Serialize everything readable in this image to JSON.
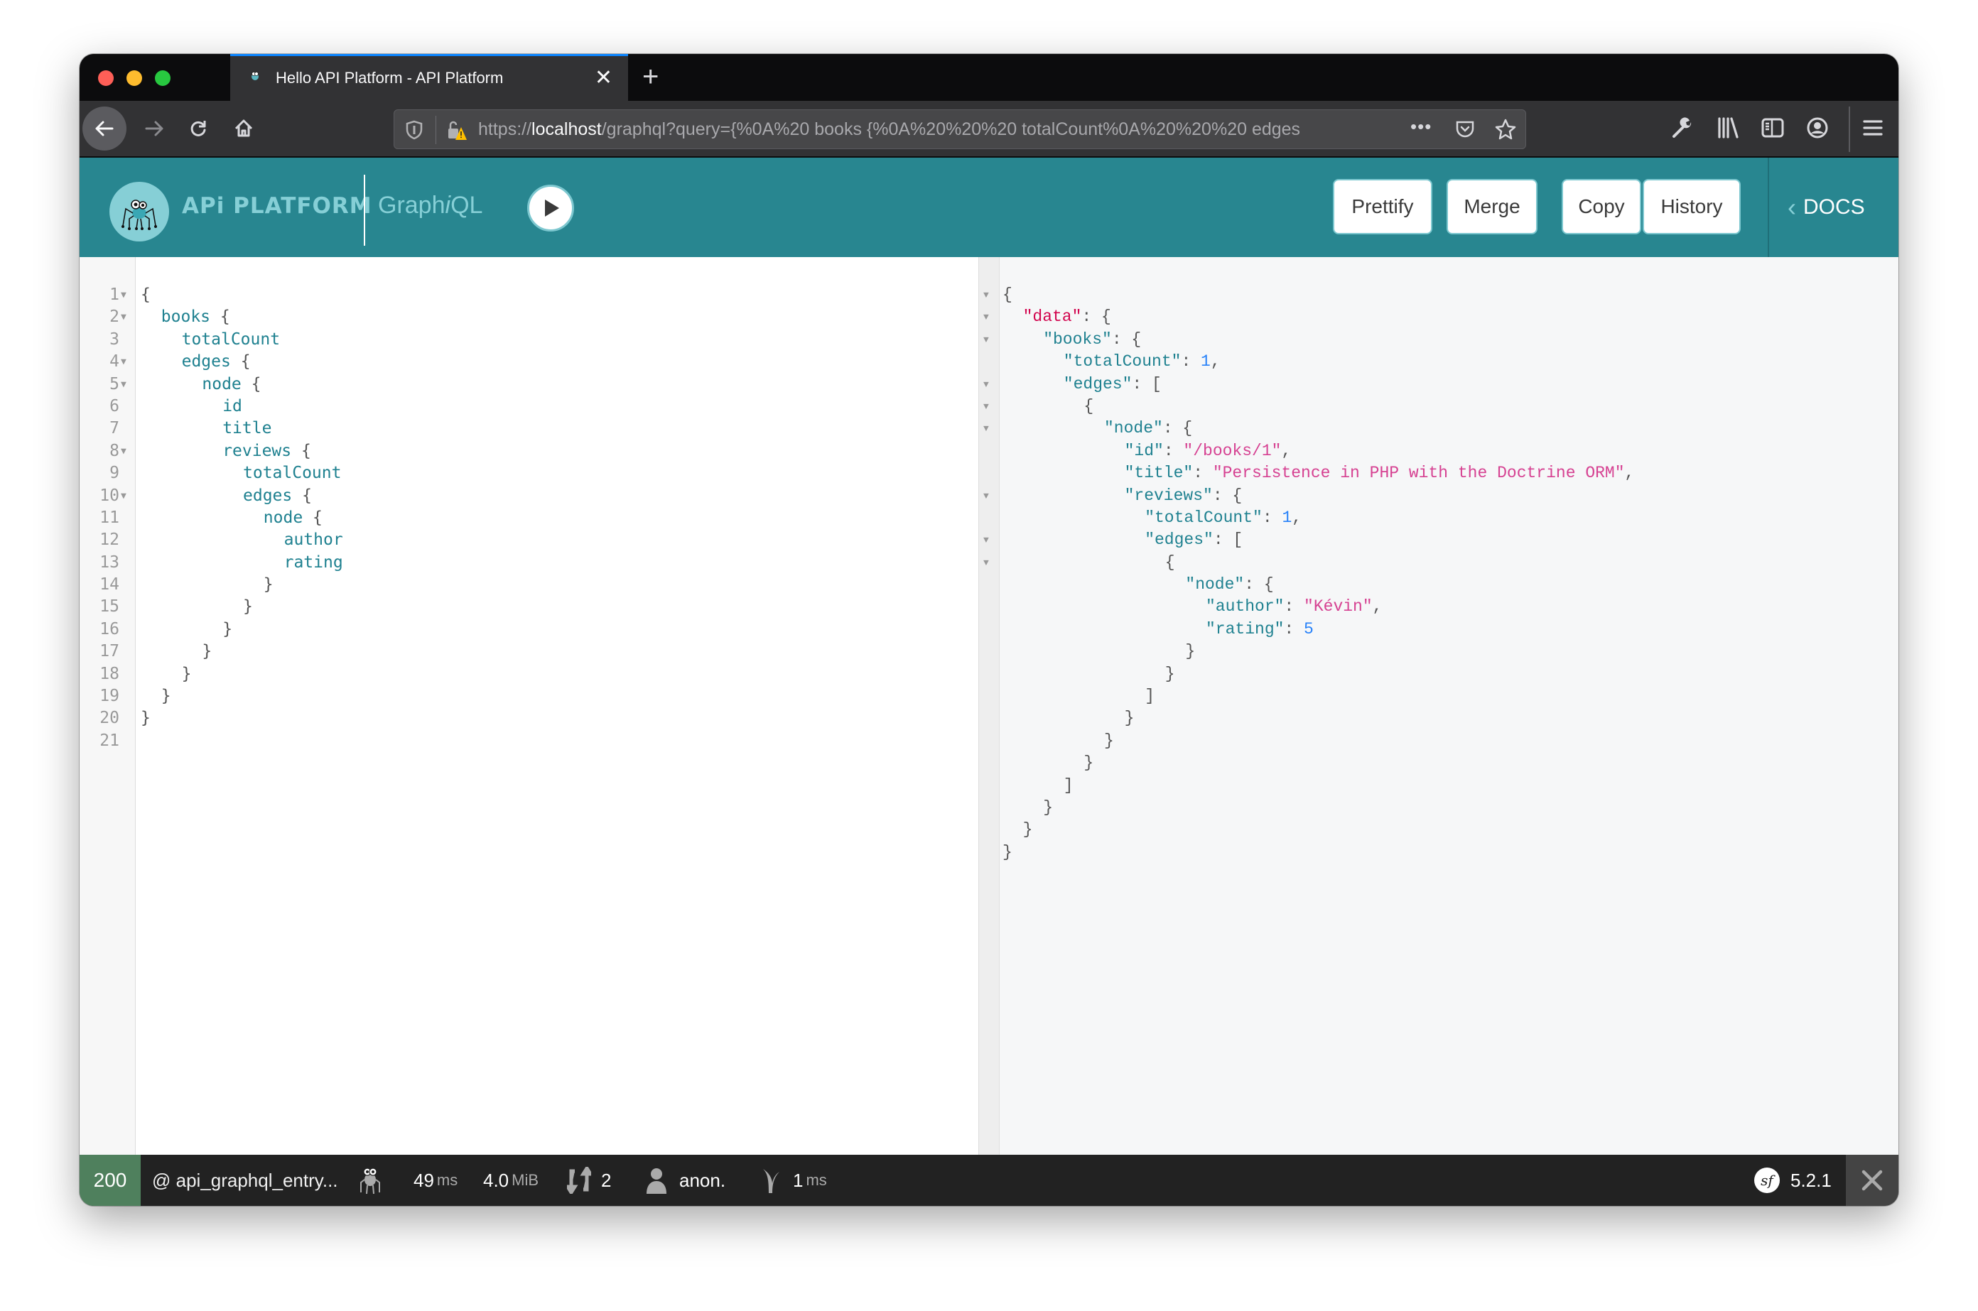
{
  "browser": {
    "tab": {
      "title": "Hello API Platform - API Platform",
      "favicon": "spider-favicon-icon"
    },
    "url": {
      "scheme": "https://",
      "host": "localhost",
      "path": "/graphql?query={%0A%20 books {%0A%20%20%20 totalCount%0A%20%20%20 edges"
    },
    "icons": [
      "back-icon",
      "forward-icon",
      "reload-icon",
      "home-icon",
      "shield-icon",
      "lock-warning-icon",
      "more-icon",
      "pocket-icon",
      "star-icon",
      "wrench-icon",
      "library-icon",
      "sidebar-icon",
      "account-icon",
      "menu-icon"
    ]
  },
  "graphiql": {
    "logo_text": "APi PLATFORM",
    "title_prefix": "Graph",
    "title_italic": "i",
    "title_suffix": "QL",
    "buttons": {
      "prettify": "Prettify",
      "merge": "Merge",
      "copy": "Copy",
      "history": "History"
    },
    "docs_label": "DOCS",
    "accent_color": "#288690"
  },
  "query_editor": {
    "lines": [
      {
        "n": "1",
        "fold": true,
        "indent": 0,
        "key": "",
        "tail": "{"
      },
      {
        "n": "2",
        "fold": true,
        "indent": 1,
        "key": "books",
        "tail": " {"
      },
      {
        "n": "3",
        "fold": false,
        "indent": 2,
        "key": "totalCount",
        "tail": ""
      },
      {
        "n": "4",
        "fold": true,
        "indent": 2,
        "key": "edges",
        "tail": " {"
      },
      {
        "n": "5",
        "fold": true,
        "indent": 3,
        "key": "node",
        "tail": " {"
      },
      {
        "n": "6",
        "fold": false,
        "indent": 4,
        "key": "id",
        "tail": ""
      },
      {
        "n": "7",
        "fold": false,
        "indent": 4,
        "key": "title",
        "tail": ""
      },
      {
        "n": "8",
        "fold": true,
        "indent": 4,
        "key": "reviews",
        "tail": " {"
      },
      {
        "n": "9",
        "fold": false,
        "indent": 5,
        "key": "totalCount",
        "tail": ""
      },
      {
        "n": "10",
        "fold": true,
        "indent": 5,
        "key": "edges",
        "tail": " {"
      },
      {
        "n": "11",
        "fold": false,
        "indent": 6,
        "key": "node",
        "tail": " {"
      },
      {
        "n": "12",
        "fold": false,
        "indent": 7,
        "key": "author",
        "tail": ""
      },
      {
        "n": "13",
        "fold": false,
        "indent": 7,
        "key": "rating",
        "tail": ""
      },
      {
        "n": "14",
        "fold": false,
        "indent": 6,
        "key": "",
        "tail": "}"
      },
      {
        "n": "15",
        "fold": false,
        "indent": 5,
        "key": "",
        "tail": "}"
      },
      {
        "n": "16",
        "fold": false,
        "indent": 4,
        "key": "",
        "tail": "}"
      },
      {
        "n": "17",
        "fold": false,
        "indent": 3,
        "key": "",
        "tail": "}"
      },
      {
        "n": "18",
        "fold": false,
        "indent": 2,
        "key": "",
        "tail": "}"
      },
      {
        "n": "19",
        "fold": false,
        "indent": 1,
        "key": "",
        "tail": "}"
      },
      {
        "n": "20",
        "fold": false,
        "indent": 0,
        "key": "",
        "tail": "}"
      },
      {
        "n": "21",
        "fold": false,
        "indent": 0,
        "key": "",
        "tail": ""
      }
    ]
  },
  "result_viewer": {
    "lines": [
      {
        "fold": true,
        "indent": 0,
        "key": "",
        "kclass": "",
        "val": "",
        "vclass": "",
        "tail": "{"
      },
      {
        "fold": true,
        "indent": 1,
        "key": "\"data\"",
        "kclass": "keyd",
        "val": "",
        "vclass": "",
        "tail": ": {"
      },
      {
        "fold": true,
        "indent": 2,
        "key": "\"books\"",
        "kclass": "key",
        "val": "",
        "vclass": "",
        "tail": ": {"
      },
      {
        "fold": false,
        "indent": 3,
        "key": "\"totalCount\"",
        "kclass": "key",
        "val": "1",
        "vclass": "num",
        "tail": ","
      },
      {
        "fold": true,
        "indent": 3,
        "key": "\"edges\"",
        "kclass": "key",
        "val": "",
        "vclass": "",
        "tail": ": ["
      },
      {
        "fold": true,
        "indent": 4,
        "key": "",
        "kclass": "",
        "val": "",
        "vclass": "",
        "tail": "{"
      },
      {
        "fold": true,
        "indent": 5,
        "key": "\"node\"",
        "kclass": "key",
        "val": "",
        "vclass": "",
        "tail": ": {"
      },
      {
        "fold": false,
        "indent": 6,
        "key": "\"id\"",
        "kclass": "key",
        "val": "\"/books/1\"",
        "vclass": "str",
        "tail": ","
      },
      {
        "fold": false,
        "indent": 6,
        "key": "\"title\"",
        "kclass": "key",
        "val": "\"Persistence in PHP with the Doctrine ORM\"",
        "vclass": "str",
        "tail": ","
      },
      {
        "fold": true,
        "indent": 6,
        "key": "\"reviews\"",
        "kclass": "key",
        "val": "",
        "vclass": "",
        "tail": ": {"
      },
      {
        "fold": false,
        "indent": 7,
        "key": "\"totalCount\"",
        "kclass": "key",
        "val": "1",
        "vclass": "num",
        "tail": ","
      },
      {
        "fold": true,
        "indent": 7,
        "key": "\"edges\"",
        "kclass": "key",
        "val": "",
        "vclass": "",
        "tail": ": ["
      },
      {
        "fold": true,
        "indent": 8,
        "key": "",
        "kclass": "",
        "val": "",
        "vclass": "",
        "tail": "{"
      },
      {
        "fold": false,
        "indent": 9,
        "key": "\"node\"",
        "kclass": "key",
        "val": "",
        "vclass": "",
        "tail": ": {"
      },
      {
        "fold": false,
        "indent": 10,
        "key": "\"author\"",
        "kclass": "key",
        "val": "\"Kévin\"",
        "vclass": "str",
        "tail": ","
      },
      {
        "fold": false,
        "indent": 10,
        "key": "\"rating\"",
        "kclass": "key",
        "val": "5",
        "vclass": "num",
        "tail": ""
      },
      {
        "fold": false,
        "indent": 9,
        "key": "",
        "kclass": "",
        "val": "",
        "vclass": "",
        "tail": "}"
      },
      {
        "fold": false,
        "indent": 8,
        "key": "",
        "kclass": "",
        "val": "",
        "vclass": "",
        "tail": "}"
      },
      {
        "fold": false,
        "indent": 7,
        "key": "",
        "kclass": "",
        "val": "",
        "vclass": "",
        "tail": "]"
      },
      {
        "fold": false,
        "indent": 6,
        "key": "",
        "kclass": "",
        "val": "",
        "vclass": "",
        "tail": "}"
      },
      {
        "fold": false,
        "indent": 5,
        "key": "",
        "kclass": "",
        "val": "",
        "vclass": "",
        "tail": "}"
      },
      {
        "fold": false,
        "indent": 4,
        "key": "",
        "kclass": "",
        "val": "",
        "vclass": "",
        "tail": "}"
      },
      {
        "fold": false,
        "indent": 3,
        "key": "",
        "kclass": "",
        "val": "",
        "vclass": "",
        "tail": "]"
      },
      {
        "fold": false,
        "indent": 2,
        "key": "",
        "kclass": "",
        "val": "",
        "vclass": "",
        "tail": "}"
      },
      {
        "fold": false,
        "indent": 1,
        "key": "",
        "kclass": "",
        "val": "",
        "vclass": "",
        "tail": "}"
      },
      {
        "fold": false,
        "indent": 0,
        "key": "",
        "kclass": "",
        "val": "",
        "vclass": "",
        "tail": "}"
      }
    ]
  },
  "debug_toolbar": {
    "status_code": "200",
    "status_color": "#4f805d",
    "route": "@ api_graphql_entry...",
    "time_value": "49",
    "time_unit": "ms",
    "memory_value": "4.0",
    "memory_unit": "MiB",
    "requests_count": "2",
    "user": "anon.",
    "twig_value": "1",
    "twig_unit": "ms",
    "symfony_version": "5.2.1"
  }
}
